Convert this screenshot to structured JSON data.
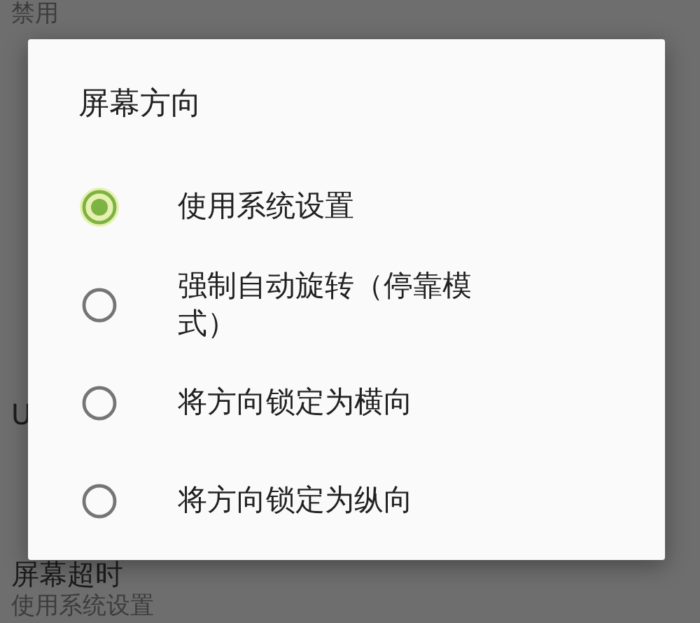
{
  "settings_list": [
    {
      "summary": "禁用"
    },
    {
      "title": "U"
    },
    {
      "title": "屏幕超时",
      "summary": "使用系统设置"
    }
  ],
  "dialog": {
    "title": "屏幕方向",
    "options": [
      {
        "label": "使用系统设置",
        "selected": true
      },
      {
        "label": "强制自动旋转（停靠模式）",
        "selected": false
      },
      {
        "label": "将方向锁定为横向",
        "selected": false
      },
      {
        "label": "将方向锁定为纵向",
        "selected": false
      }
    ]
  }
}
